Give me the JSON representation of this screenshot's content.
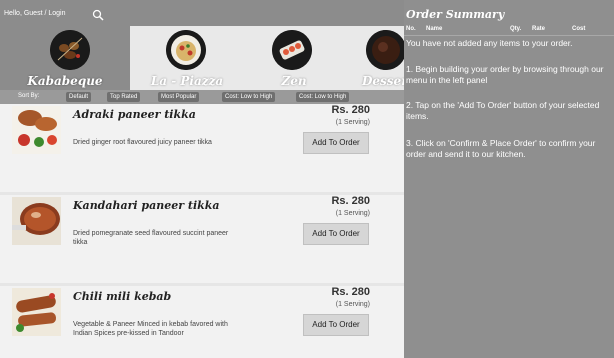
{
  "header": {
    "greeting": "Hello, Guest / Login"
  },
  "categories": [
    {
      "name": "Kababeque",
      "active": true
    },
    {
      "name": "La - Piazza",
      "active": false
    },
    {
      "name": "Zen",
      "active": false
    },
    {
      "name": "Desser",
      "active": false
    }
  ],
  "sort": {
    "label": "Sort By:",
    "options": [
      "Default",
      "Top Rated",
      "Most Popular",
      "Cost: Low to High",
      "Cost: Low to High"
    ]
  },
  "menu_items": [
    {
      "name": "Adraki paneer tikka",
      "description": "Dried ginger root flavoured juicy paneer tikka",
      "price": "Rs. 280",
      "serving": "(1 Serving)",
      "button": "Add To Order"
    },
    {
      "name": "Kandahari paneer tikka",
      "description": "Dried pomegranate seed flavoured succint paneer tikka",
      "price": "Rs. 280",
      "serving": "(1 Serving)",
      "button": "Add To Order"
    },
    {
      "name": "Chili mili kebab",
      "description": "Vegetable & Paneer Minced in kebab favored with Indian Spices pre-kissed in Tandoor",
      "price": "Rs. 280",
      "serving": "(1 Serving)",
      "button": "Add To Order"
    }
  ],
  "order_summary": {
    "title": "Order Summary",
    "columns": [
      "No.",
      "Name",
      "Qty.",
      "Rate",
      "Cost"
    ],
    "empty_message": "You have not added any items to your order.",
    "steps": [
      "1. Begin building your order by browsing through our menu in the left panel",
      "2. Tap on the 'Add To Order' button of your selected items.",
      "3. Click on 'Confirm & Place Order' to confirm your order and send it to our kitchen."
    ]
  },
  "colors": {
    "panel_gray": "#8f8f8f",
    "item_bg": "#f2f2f2",
    "button_bg": "#d6d6d6"
  }
}
